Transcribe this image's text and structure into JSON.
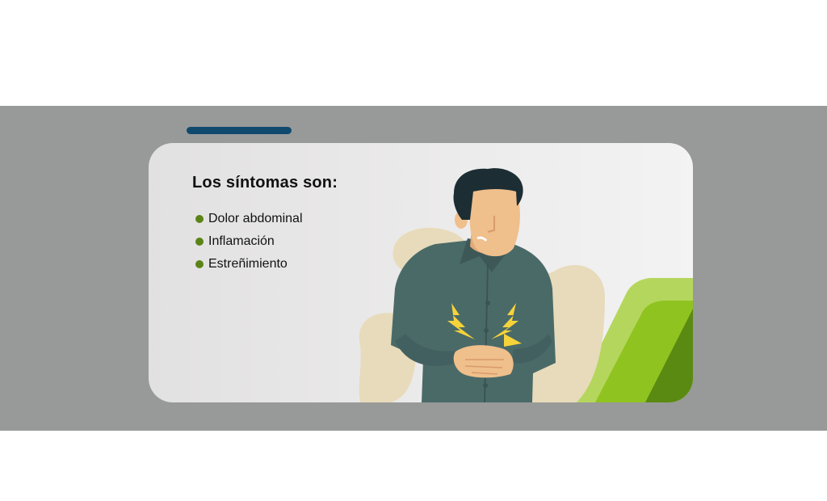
{
  "card": {
    "title": "Los síntomas son:",
    "symptoms": [
      "Dolor abdominal",
      "Inflamación",
      "Estreñimiento"
    ]
  },
  "icons": [
    "bullet-dot",
    "man-stomach-pain-illustration",
    "pain-bolt-icon",
    "green-stripes-decoration"
  ],
  "colors": {
    "band": "#989999",
    "accent_bar": "#0f4a6e",
    "bullet": "#5b8418",
    "shirt": "#4a6a68",
    "hair": "#1c2e33",
    "skin": "#efbf8c",
    "blob": "#e7dbbb",
    "bolt": "#f6d33a",
    "stripe_light": "#b5d65d",
    "stripe_mid": "#8fc31f",
    "stripe_dark": "#5a8a12"
  }
}
